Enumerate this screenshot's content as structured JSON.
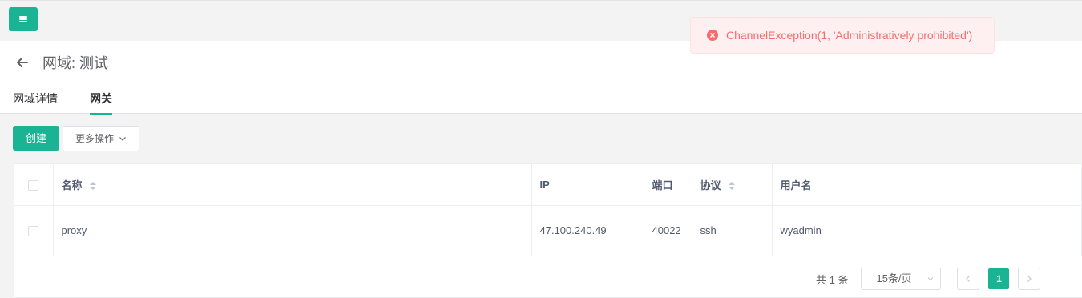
{
  "topbar": {
    "menu_icon": "hamburger-icon"
  },
  "header": {
    "title": "网域: 测试",
    "tabs": [
      {
        "label": "网域详情",
        "active": false
      },
      {
        "label": "网关",
        "active": true
      }
    ]
  },
  "toolbar": {
    "create_label": "创建",
    "more_label": "更多操作"
  },
  "table": {
    "columns": [
      "名称",
      "IP",
      "端口",
      "协议",
      "用户名"
    ],
    "rows": [
      {
        "name": "proxy",
        "ip": "47.100.240.49",
        "port": "40022",
        "protocol": "ssh",
        "username": "wyadmin"
      }
    ]
  },
  "pagination": {
    "total": "共 1 条",
    "page_size": "15条/页",
    "current_page": "1"
  },
  "toast": {
    "message": "ChannelException(1, 'Administratively prohibited')",
    "type": "error"
  },
  "colors": {
    "accent": "#1ab394",
    "error": "#f56c6c"
  }
}
